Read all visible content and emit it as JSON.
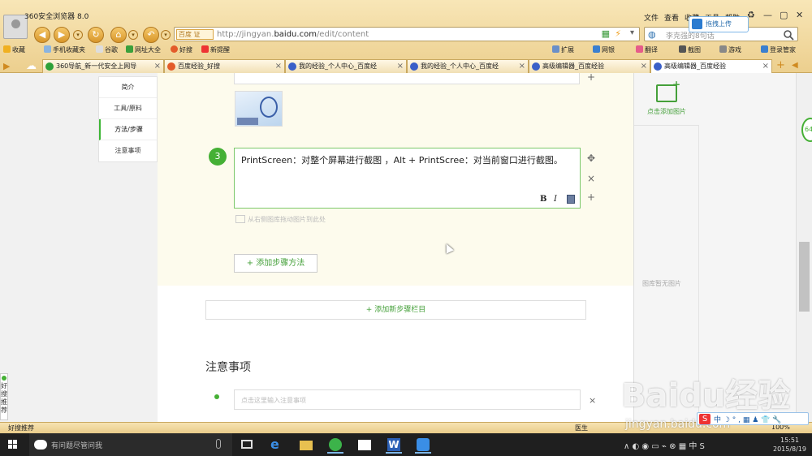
{
  "window": {
    "title": "360安全浏览器 8.0",
    "menu": [
      "文件",
      "查看",
      "收藏",
      "工具",
      "帮助"
    ]
  },
  "toolbar": {
    "back_icon": "back-arrow-icon",
    "forward_icon": "forward-arrow-icon",
    "refresh_icon": "refresh-icon",
    "home_icon": "home-icon",
    "undo_icon": "undo-icon"
  },
  "address": {
    "engine_label": "百度",
    "badge": "证",
    "url_prefix": "http://jingyan.",
    "url_domain": "baidu.com",
    "url_suffix": "/edit/content"
  },
  "search": {
    "placeholder": "李克强的8句话"
  },
  "drag_upload": "拖拽上传",
  "bookmarks": {
    "left": [
      "收藏",
      "手机收藏夹",
      "谷歌",
      "网址大全",
      "好搜",
      "新提醒"
    ],
    "right": [
      "扩展",
      "网银",
      "翻译",
      "截图",
      "游戏",
      "登录管家"
    ]
  },
  "tabs": [
    {
      "title": "360导航_新一代安全上网导",
      "active": false
    },
    {
      "title": "百度经验_好搜",
      "active": false
    },
    {
      "title": "我的经验_个人中心_百度经",
      "active": false
    },
    {
      "title": "我的经验_个人中心_百度经",
      "active": false
    },
    {
      "title": "高级编辑器_百度经验",
      "active": false
    },
    {
      "title": "高级编辑器_百度经验",
      "active": true
    }
  ],
  "sidenav": [
    {
      "label": "简介",
      "active": false
    },
    {
      "label": "工具/原料",
      "active": false
    },
    {
      "label": "方法/步骤",
      "active": true
    },
    {
      "label": "注意事项",
      "active": false
    }
  ],
  "step": {
    "number": "3",
    "text": "PrintScreen：对整个屏幕进行截图 ，Alt + PrintScree：对当前窗口进行截图。",
    "bold": "B",
    "italic": "I",
    "drop_hint": "从右侧图库拖动图片到此处",
    "move": "✥",
    "close": "×",
    "add": "+"
  },
  "add_method": "+ 添加步骤方法",
  "add_step_column": "+ 添加新步骤栏目",
  "notice": {
    "title": "注意事项",
    "placeholder": "点击这里输入注意事项",
    "close": "×"
  },
  "right_panel": {
    "add_image": "点击添加图片",
    "gallery_empty": "图库暂无图片"
  },
  "float_badge": "64",
  "left_float": "好搜推荐",
  "status": {
    "left": "好搜推荐",
    "right": "医生",
    "zoom": "100%"
  },
  "ime": {
    "logo": "S",
    "items": "中 ☽ ° , ▦ ♟ 👕 🔧"
  },
  "taskbar": {
    "search_placeholder": "有问题尽管问我",
    "tray": "∧  ◐  ◉  ▭  ⌁  ⊗  ▦  中  S",
    "time": "15:51",
    "date": "2015/8/19"
  },
  "watermark": {
    "brand": "Baidu经验",
    "url": "jingyan.baidu.com"
  },
  "colors": {
    "chrome": "#eccf8e",
    "accent_green": "#45b035",
    "step_bg": "#fdfbed"
  }
}
